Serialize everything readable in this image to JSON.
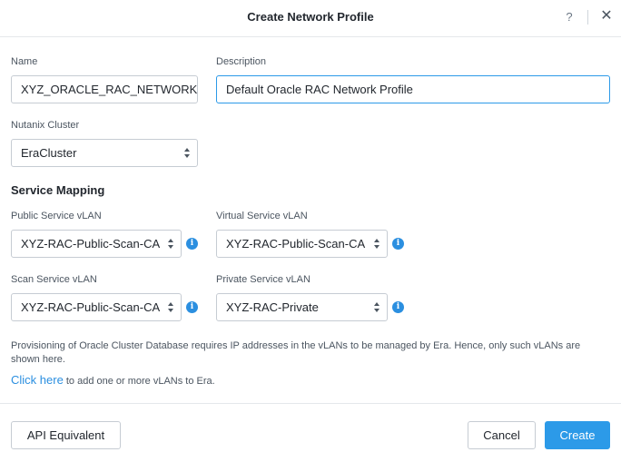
{
  "dialog": {
    "title": "Create Network Profile",
    "help_label": "?",
    "close_label": "✕"
  },
  "form": {
    "name_label": "Name",
    "name_value": "XYZ_ORACLE_RAC_NETWORK",
    "description_label": "Description",
    "description_value": "Default Oracle RAC Network Profile",
    "cluster_label": "Nutanix Cluster",
    "cluster_value": "EraCluster"
  },
  "service_mapping": {
    "heading": "Service Mapping",
    "public_label": "Public Service vLAN",
    "public_value": "XYZ-RAC-Public-Scan-CA",
    "virtual_label": "Virtual Service vLAN",
    "virtual_value": "XYZ-RAC-Public-Scan-CA",
    "scan_label": "Scan Service vLAN",
    "scan_value": "XYZ-RAC-Public-Scan-CA",
    "private_label": "Private Service vLAN",
    "private_value": "XYZ-RAC-Private",
    "info_glyph": "i"
  },
  "notice": {
    "text": "Provisioning of Oracle Cluster Database requires IP addresses in the vLANs to be managed by Era. Hence, only such vLANs are shown here.",
    "link_label": "Click here",
    "link_suffix": " to add one or more vLANs to Era."
  },
  "footer": {
    "api_label": "API Equivalent",
    "cancel_label": "Cancel",
    "create_label": "Create"
  },
  "colors": {
    "accent": "#2c9ae8",
    "border": "#c6ccd3",
    "text": "#22272e",
    "muted": "#4b5560"
  }
}
